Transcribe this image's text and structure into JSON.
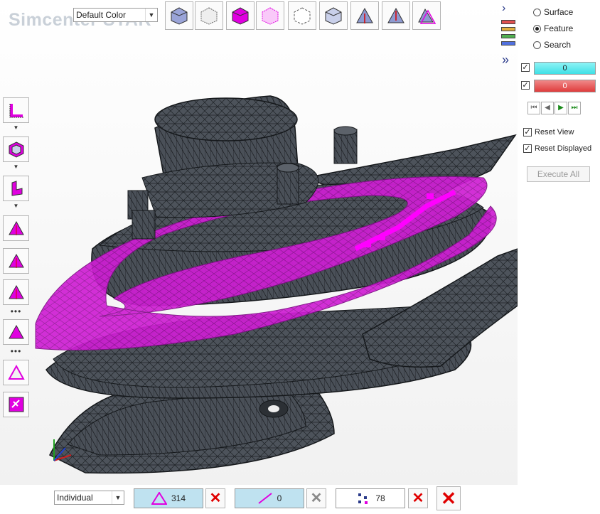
{
  "brand": "Simcenter STAR",
  "color_select": {
    "value": "Default Color"
  },
  "top_toolbar": [
    {
      "icon": "cube-shaded-icon"
    },
    {
      "icon": "cube-wireframe-icon"
    },
    {
      "icon": "cube-magenta-shaded-icon"
    },
    {
      "icon": "cube-magenta-wireframe-icon"
    },
    {
      "icon": "cube-dashed-icon"
    },
    {
      "icon": "cube-outline-icon"
    },
    {
      "icon": "triangle-normal-icon"
    },
    {
      "icon": "triangle-flip-icon"
    },
    {
      "icon": "triangle-pair-icon"
    }
  ],
  "left_toolbar": [
    {
      "icon": "l-shape-icon"
    },
    {
      "icon": "box-select-icon"
    },
    {
      "icon": "face-select-icon"
    },
    {
      "icon": "triangle-arrows-icon"
    },
    {
      "icon": "triangle-arrows-icon"
    },
    {
      "icon": "triangle-arrows-icon"
    },
    {
      "icon": "triangle-magenta-icon"
    },
    {
      "icon": "triangle-outline-icon"
    },
    {
      "icon": "link-edit-icon"
    }
  ],
  "side_panel": {
    "options": [
      {
        "label": "Surface",
        "selected": false
      },
      {
        "label": "Feature",
        "selected": true
      },
      {
        "label": "Search",
        "selected": false
      }
    ],
    "bar1": {
      "value": "0",
      "color": "#3ee0e6"
    },
    "bar2": {
      "value": "0",
      "color": "#e03c3c"
    },
    "reset_view": "Reset View",
    "reset_displayed": "Reset Displayed",
    "execute_all": "Execute All"
  },
  "bottom_bar": {
    "mode_select": "Individual",
    "faces_count": "314",
    "edges_count": "0",
    "vertices_count": "78"
  },
  "colors": {
    "accent": "#e000e0",
    "mesh": "#4c5159",
    "field_bg": "#bfe2f0"
  }
}
